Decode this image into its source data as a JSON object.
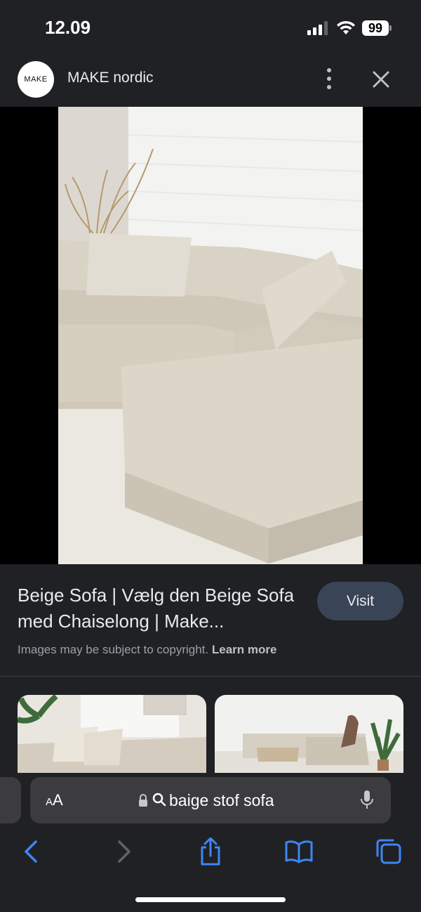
{
  "status_bar": {
    "time": "12.09",
    "battery": "99"
  },
  "header": {
    "logo_text": "MAKE",
    "site_name": "MAKE nordic"
  },
  "result": {
    "title": "Beige Sofa | Vælg den Beige Sofa med Chaiselong | Make...",
    "visit_label": "Visit",
    "copyright_text": "Images may be subject to copyright.",
    "learn_more": "Learn more"
  },
  "related_items": [
    {
      "icon": "sofa-room-thumbnail"
    },
    {
      "icon": "living-room-thumbnail"
    }
  ],
  "browser": {
    "aa_small": "A",
    "aa_large": "A",
    "address": "baige stof sofa"
  },
  "colors": {
    "accent": "#3d86f5",
    "visit_bg": "#394457",
    "background": "#202124"
  }
}
